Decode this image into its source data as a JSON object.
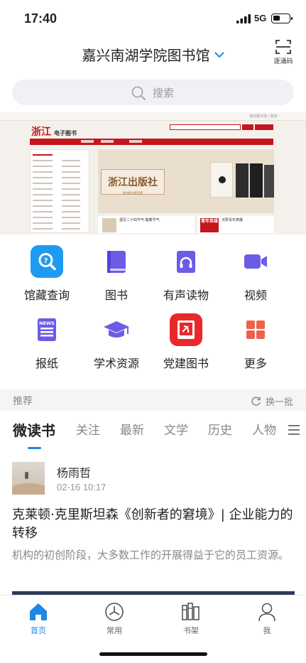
{
  "status_bar": {
    "time": "17:40",
    "network": "5G"
  },
  "header": {
    "library_title": "嘉兴南湖学院图书馆",
    "scan_label": "逐涌码"
  },
  "search": {
    "placeholder": "搜索"
  },
  "banner": {
    "logo_text": "浙江",
    "logo_sub": "电子图书",
    "publisher_text": "浙江出版社",
    "publisher_sub": "好书好书享不停",
    "news1": "遇见二十四节气·醒着节气",
    "news2": "点赞青年英雄",
    "news2_cover": "青年英雄",
    "top_links": "我的图书馆 | 服务"
  },
  "features": [
    {
      "label": "馆藏查询",
      "icon": "search-icon",
      "color": "#1e9bf0"
    },
    {
      "label": "图书",
      "icon": "book-icon",
      "color": "#6b5ce7"
    },
    {
      "label": "有声读物",
      "icon": "audiobook-icon",
      "color": "#6b5ce7"
    },
    {
      "label": "视频",
      "icon": "video-icon",
      "color": "#6b5ce7"
    },
    {
      "label": "报纸",
      "icon": "newspaper-icon",
      "color": "#6b5ce7",
      "badge": "NEWS"
    },
    {
      "label": "学术资源",
      "icon": "graduation-cap-icon",
      "color": "#6b5ce7"
    },
    {
      "label": "党建图书",
      "icon": "party-book-icon",
      "color": "#e8282b"
    },
    {
      "label": "更多",
      "icon": "grid-icon",
      "color": "#f0614d"
    }
  ],
  "recommend": {
    "title": "推荐",
    "refresh_label": "换一批"
  },
  "tabs": [
    "微读书",
    "关注",
    "最新",
    "文学",
    "历史",
    "人物"
  ],
  "article": {
    "author": "杨雨哲",
    "date": "02-16 10:17",
    "title": "克莱顿·克里斯坦森《创新者的窘境》| 企业能力的转移",
    "summary": "机构的初创阶段，大多数工作的开展得益于它的员工资源。"
  },
  "bottom_nav": [
    {
      "label": "首页",
      "icon": "home-icon",
      "active": true
    },
    {
      "label": "常用",
      "icon": "compass-icon",
      "active": false
    },
    {
      "label": "书架",
      "icon": "bookshelf-icon",
      "active": false
    },
    {
      "label": "我",
      "icon": "user-icon",
      "active": false
    }
  ],
  "colors": {
    "accent": "#1e88e5",
    "purple": "#6b5ce7",
    "red": "#e8282b"
  }
}
